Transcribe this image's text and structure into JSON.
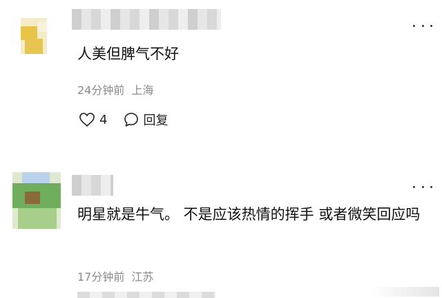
{
  "comments": [
    {
      "username": "",
      "content": "人美但脾气不好",
      "time": "24分钟前",
      "location": "上海",
      "likes": "4",
      "reply_label": "回复",
      "avatar_colors": [
        "#f2e3a3",
        "#e8c95c",
        "#f6efd0",
        "#d9b23a"
      ]
    },
    {
      "username": "",
      "content": "明星就是牛气。 不是应该热情的挥手 或者微笑回应吗",
      "time": "17分钟前",
      "location": "江苏",
      "likes": "",
      "reply_label": "",
      "avatar_colors": [
        "#a9c8e6",
        "#6fb36a",
        "#7a6a3a",
        "#cfe6b9"
      ]
    }
  ],
  "icons": {
    "more": "more-dots-icon",
    "like": "heart-icon",
    "reply": "speech-bubble-icon"
  }
}
